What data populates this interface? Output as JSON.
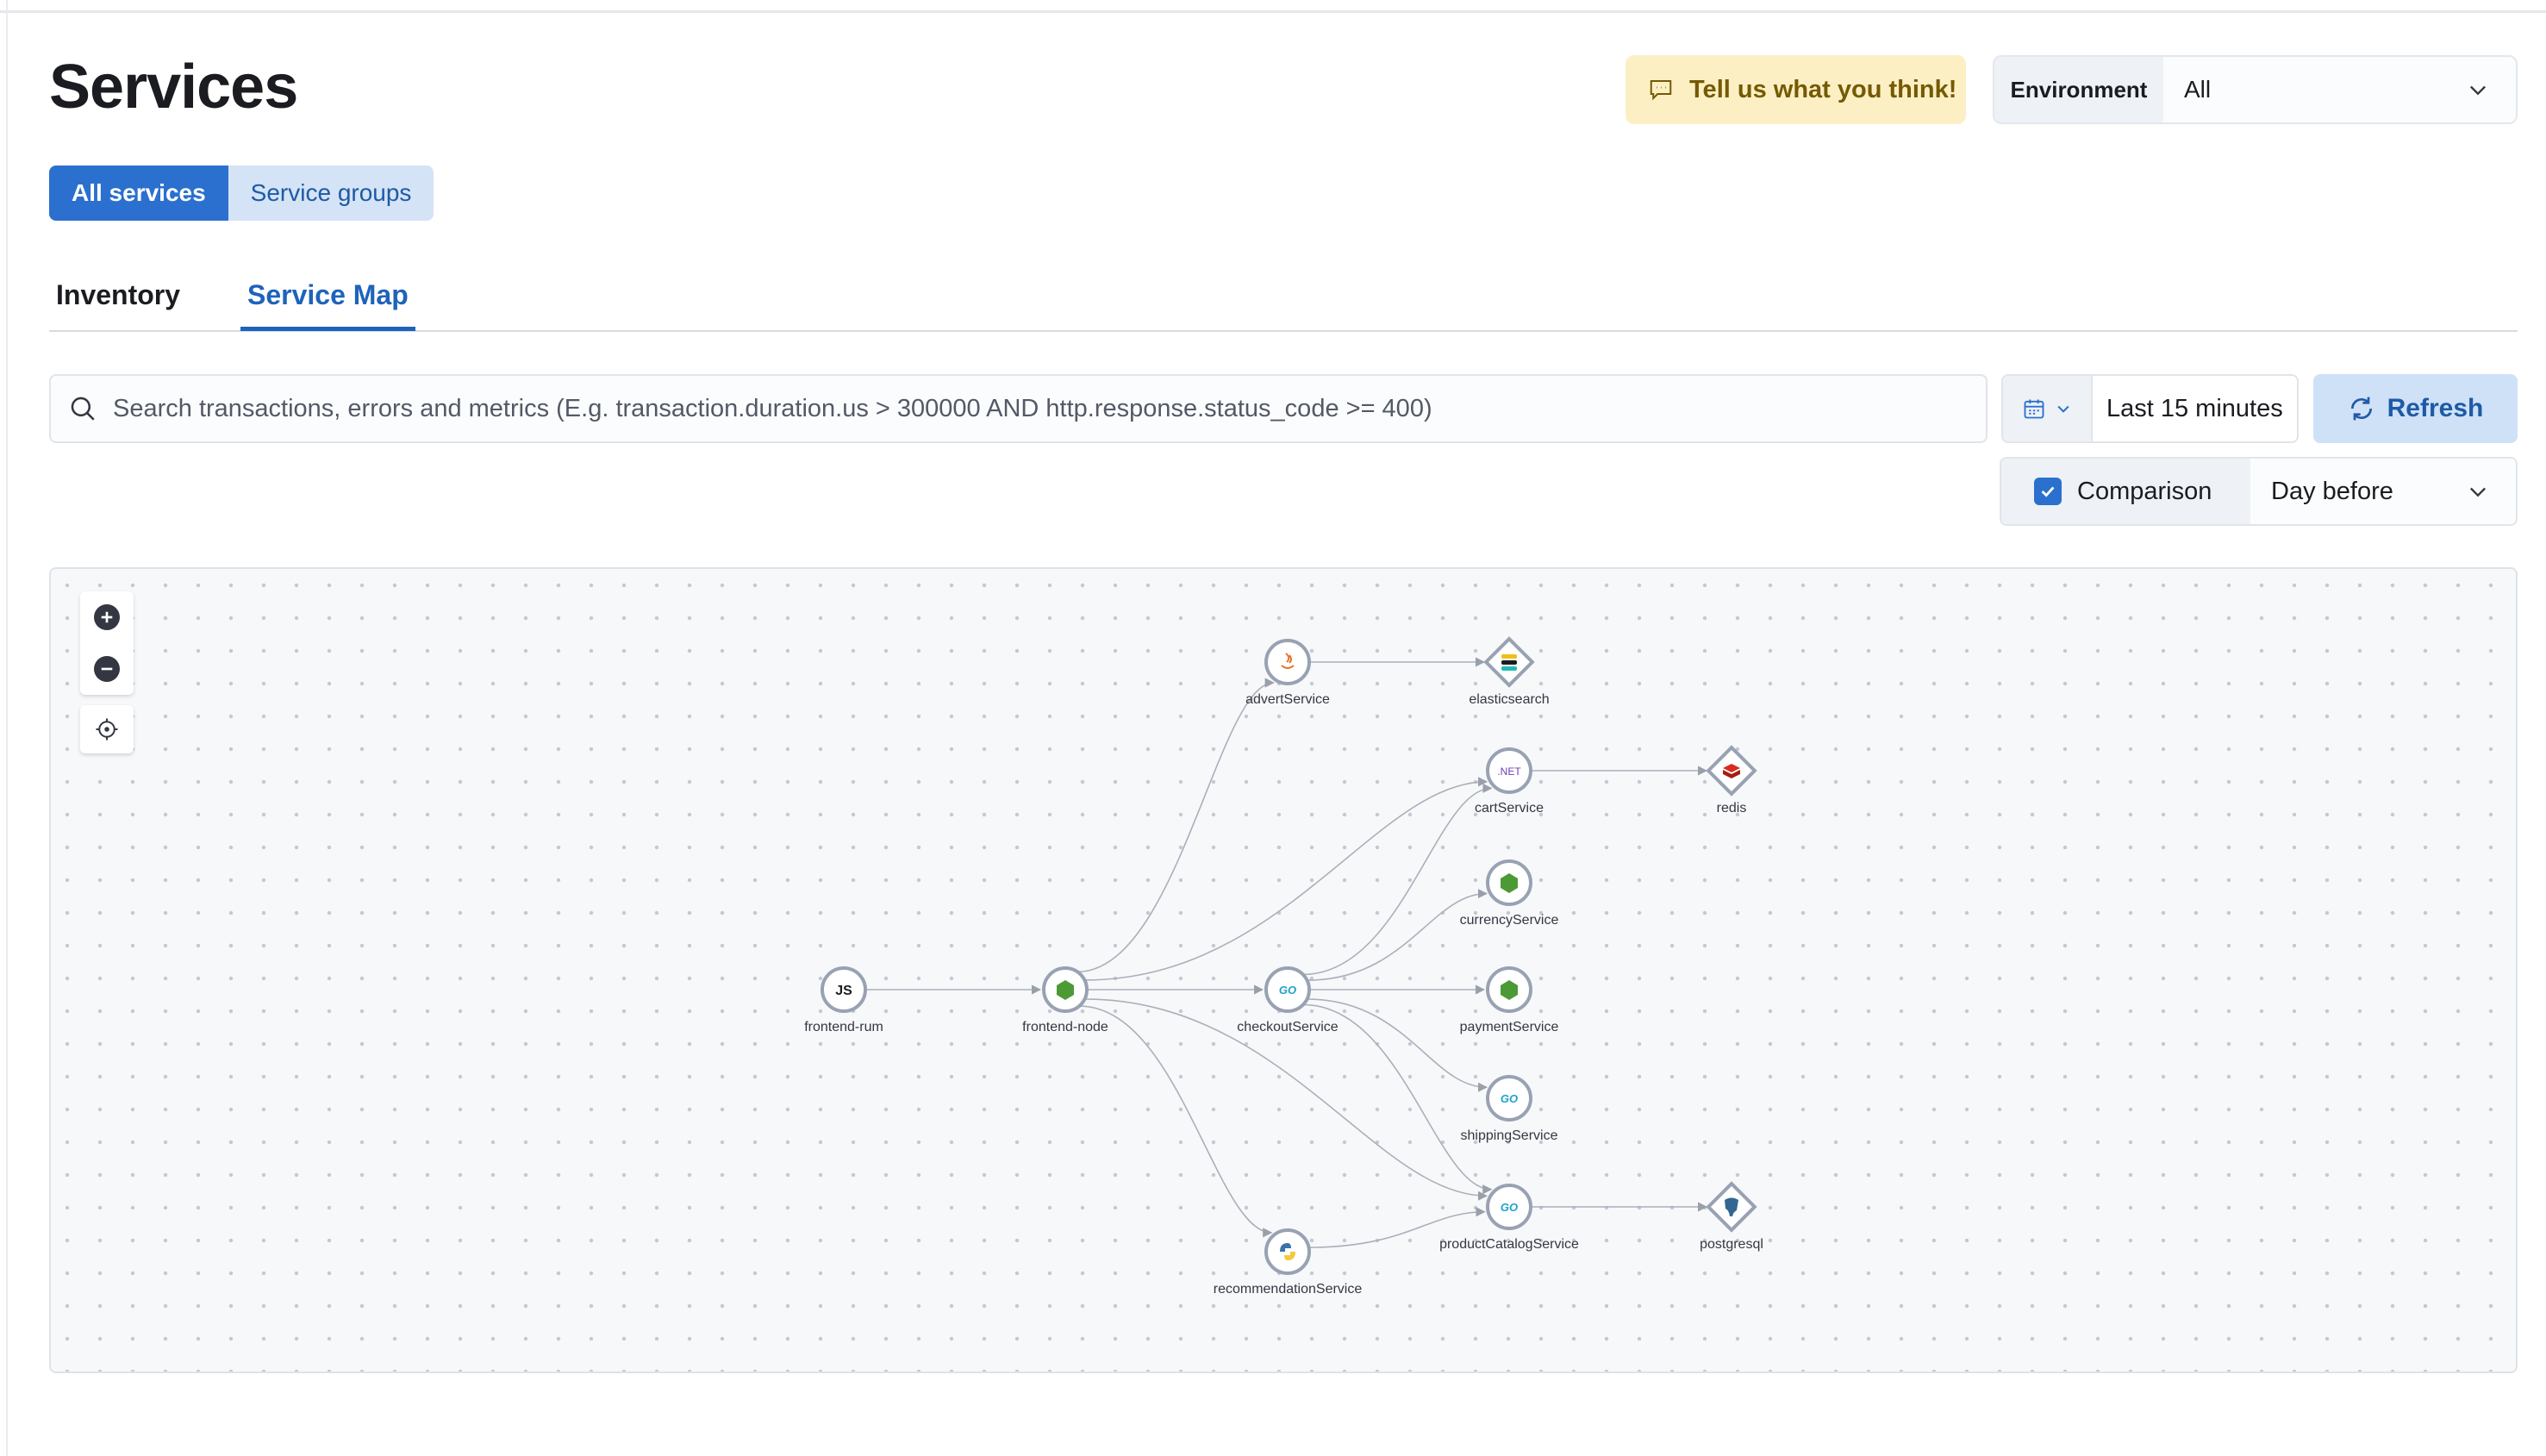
{
  "page": {
    "title": "Services",
    "feedback_label": "Tell us what you think!",
    "environment": {
      "label": "Environment",
      "value": "All"
    }
  },
  "segmented": {
    "all": "All services",
    "groups": "Service groups"
  },
  "tabs": {
    "inventory": "Inventory",
    "service_map": "Service Map"
  },
  "search": {
    "placeholder": "Search transactions, errors and metrics (E.g. transaction.duration.us > 300000 AND http.response.status_code >= 400)"
  },
  "date": {
    "range": "Last 15 minutes"
  },
  "refresh_label": "Refresh",
  "comparison": {
    "label": "Comparison",
    "checked": true,
    "value": "Day before"
  },
  "colors": {
    "primary": "#2b70ce",
    "node_border": "#98a2b3",
    "edge": "#aab0ba"
  },
  "service_map": {
    "nodes": [
      {
        "id": "frontend-rum",
        "label": "frontend-rum",
        "kind": "service",
        "icon": "js-icon"
      },
      {
        "id": "frontend-node",
        "label": "frontend-node",
        "kind": "service",
        "icon": "nodejs-icon"
      },
      {
        "id": "advertService",
        "label": "advertService",
        "kind": "service",
        "icon": "java-icon"
      },
      {
        "id": "elasticsearch",
        "label": "elasticsearch",
        "kind": "dependency",
        "icon": "elasticsearch-icon"
      },
      {
        "id": "cartService",
        "label": "cartService",
        "kind": "service",
        "icon": "dotnet-icon"
      },
      {
        "id": "redis",
        "label": "redis",
        "kind": "dependency",
        "icon": "redis-icon"
      },
      {
        "id": "currencyService",
        "label": "currencyService",
        "kind": "service",
        "icon": "nodejs-icon"
      },
      {
        "id": "checkoutService",
        "label": "checkoutService",
        "kind": "service",
        "icon": "go-icon"
      },
      {
        "id": "paymentService",
        "label": "paymentService",
        "kind": "service",
        "icon": "nodejs-icon"
      },
      {
        "id": "shippingService",
        "label": "shippingService",
        "kind": "service",
        "icon": "go-icon"
      },
      {
        "id": "productCatalogService",
        "label": "productCatalogService",
        "kind": "service",
        "icon": "go-icon"
      },
      {
        "id": "postgresql",
        "label": "postgresql",
        "kind": "dependency",
        "icon": "postgresql-icon"
      },
      {
        "id": "recommendationService",
        "label": "recommendationService",
        "kind": "service",
        "icon": "python-icon"
      }
    ],
    "edges": [
      [
        "frontend-rum",
        "frontend-node"
      ],
      [
        "frontend-node",
        "advertService"
      ],
      [
        "frontend-node",
        "cartService"
      ],
      [
        "frontend-node",
        "checkoutService"
      ],
      [
        "frontend-node",
        "productCatalogService"
      ],
      [
        "frontend-node",
        "recommendationService"
      ],
      [
        "advertService",
        "elasticsearch"
      ],
      [
        "cartService",
        "redis"
      ],
      [
        "checkoutService",
        "cartService"
      ],
      [
        "checkoutService",
        "currencyService"
      ],
      [
        "checkoutService",
        "paymentService"
      ],
      [
        "checkoutService",
        "shippingService"
      ],
      [
        "checkoutService",
        "productCatalogService"
      ],
      [
        "recommendationService",
        "productCatalogService"
      ],
      [
        "productCatalogService",
        "postgresql"
      ]
    ]
  }
}
